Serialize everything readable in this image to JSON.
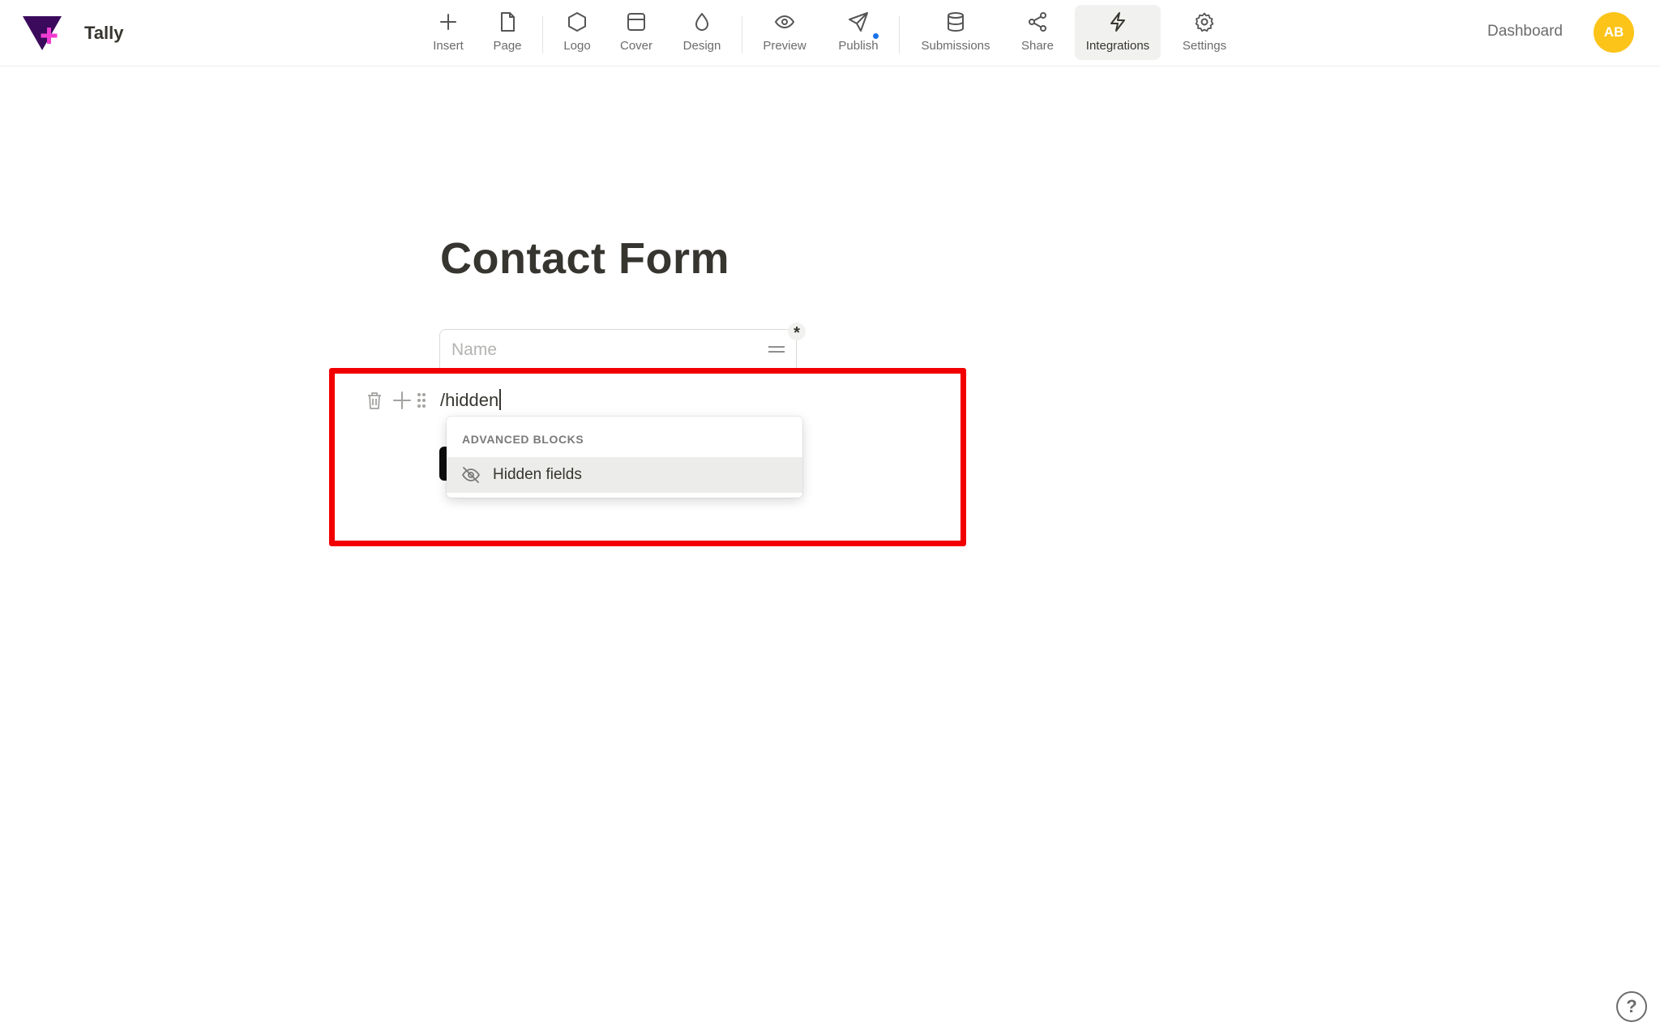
{
  "app": {
    "name": "Tally"
  },
  "toolbar": {
    "items": [
      {
        "label": "Insert",
        "icon": "plus-icon"
      },
      {
        "label": "Page",
        "icon": "page-icon"
      },
      {
        "label": "Logo",
        "icon": "hexagon-icon"
      },
      {
        "label": "Cover",
        "icon": "cover-icon"
      },
      {
        "label": "Design",
        "icon": "droplet-icon"
      },
      {
        "label": "Preview",
        "icon": "eye-icon"
      },
      {
        "label": "Publish",
        "icon": "send-icon",
        "has_notification": true
      },
      {
        "label": "Submissions",
        "icon": "database-icon"
      },
      {
        "label": "Share",
        "icon": "share-icon"
      },
      {
        "label": "Integrations",
        "icon": "lightning-icon",
        "active": true
      },
      {
        "label": "Settings",
        "icon": "gear-icon"
      }
    ]
  },
  "header": {
    "dashboard_label": "Dashboard",
    "avatar_initials": "AB"
  },
  "form": {
    "title": "Contact Form",
    "fields": [
      {
        "placeholder": "Name",
        "required": true,
        "required_marker": "*"
      }
    ],
    "slash_input": "/hidden"
  },
  "slash_menu": {
    "section_label": "ADVANCED BLOCKS",
    "items": [
      {
        "label": "Hidden fields",
        "icon": "eye-off-icon",
        "highlighted": true
      }
    ]
  },
  "help": {
    "label": "?"
  },
  "colors": {
    "accent_highlight": "#f20000",
    "avatar_bg": "#fcc419",
    "notification_dot": "#1a73e8",
    "logo_purple": "#3b0a5c",
    "logo_pink": "#f03cd2"
  }
}
